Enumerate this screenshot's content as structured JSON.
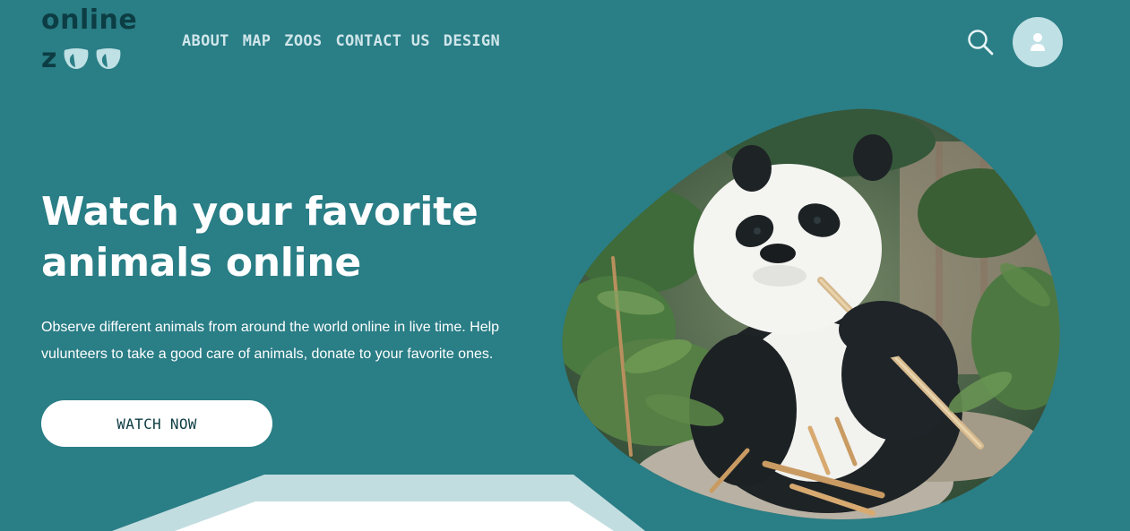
{
  "logo": {
    "line1": "online",
    "line2_letter": "z",
    "color": "#0d3d44",
    "eye_color": "#bfe0e4"
  },
  "nav": {
    "items": [
      {
        "label": "ABOUT"
      },
      {
        "label": "MAP"
      },
      {
        "label": "ZOOS"
      },
      {
        "label": "CONTACT US"
      },
      {
        "label": "DESIGN"
      }
    ]
  },
  "header": {
    "search_icon": "search-icon",
    "avatar_icon": "user-icon"
  },
  "hero": {
    "title": "Watch your favorite animals online",
    "subtitle": "Observe different animals from around the world online in live time. Help vulunteers to take a good care of animals, donate to your favorite ones.",
    "cta_label": "WATCH NOW",
    "image_subject": "giant panda eating bamboo"
  },
  "colors": {
    "background": "#2a7e86",
    "nav_text": "#cfe6ea",
    "accent_light": "#bfe0e4",
    "dark_teal": "#0d3d44",
    "white": "#ffffff"
  }
}
